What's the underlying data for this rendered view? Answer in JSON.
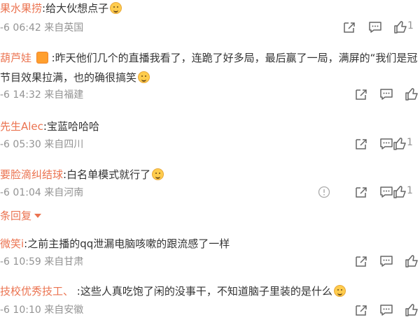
{
  "comments": [
    {
      "user": "果水果捞",
      "text": ":给大伙想点子",
      "lines": [],
      "emoji": "smile-face",
      "meta": "-6 06:42 来自英国",
      "likes": "1"
    },
    {
      "user": "葫芦娃",
      "badge": "crown-badge",
      "text": " :昨天他们几个的直播我看了，连跪了好多局，最后赢了一局，满屏的“我们是冠",
      "lines": [
        "节目效果拉满，也的确很搞笑"
      ],
      "emoji": "grin-face",
      "meta": "-6 14:32 来自福建",
      "likes": ""
    },
    {
      "user": "先生Alec",
      "text": ":宝蓝哈哈哈",
      "lines": [],
      "meta": "-6 05:30 来自四川",
      "likes": "1"
    },
    {
      "user": "要脸滴纠结球",
      "text": ":白名单模式就行了",
      "lines": [],
      "emoji": "laugh-face",
      "meta": "-6 01:04 来自河南",
      "likes": "1"
    },
    {
      "user": "微笑i",
      "text": ":之前主播的qq泄漏电脑咳嗽的跟流感了一样",
      "lines": [],
      "meta": "-6 10:59 来自甘肃",
      "likes": ""
    },
    {
      "user": "技校优秀技工、",
      "text": " :这些人真吃饱了闲的没事干，不知道脑子里装的是什么",
      "lines": [],
      "emoji": "cry-face",
      "meta": "-6 10:10 来自安徽",
      "likes": ""
    }
  ],
  "more_replies": "条回复",
  "icons": {
    "share": "share-icon",
    "comment": "comment-icon",
    "like": "thumbs-up-icon",
    "report": "report-icon"
  },
  "colors": {
    "username": "#eb7350",
    "meta": "#939393",
    "text": "#333333"
  }
}
